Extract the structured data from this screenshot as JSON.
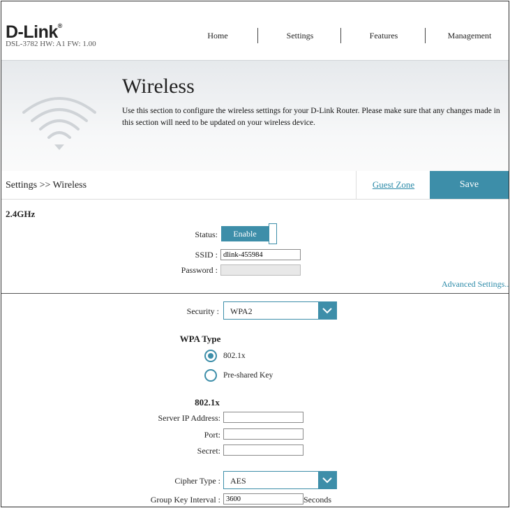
{
  "brand": {
    "logo": "D-Link",
    "model_info": "DSL-3782  HW: A1  FW: 1.00"
  },
  "nav": [
    {
      "label": "Home"
    },
    {
      "label": "Settings"
    },
    {
      "label": "Features"
    },
    {
      "label": "Management"
    }
  ],
  "banner": {
    "title": "Wireless",
    "description": "Use this section to configure the wireless settings for your D-Link Router. Please make sure that any changes made in this section will need to be updated on your wireless device.",
    "icon": "wifi-icon"
  },
  "breadcrumb": "Settings >> Wireless",
  "actions": {
    "guest_zone": "Guest Zone",
    "save": "Save"
  },
  "band": {
    "title": "2.4GHz",
    "status_label": "Status:",
    "status_value": "Enable",
    "ssid_label": "SSID :",
    "ssid_value": "dlink-455984",
    "password_label": "Password :",
    "password_value": "",
    "advanced_link": "Advanced Settings..."
  },
  "security": {
    "label": "Security :",
    "value": "WPA2",
    "wpa_type_title": "WPA Type",
    "wpa_options": [
      {
        "label": "802.1x",
        "checked": true
      },
      {
        "label": "Pre-shared Key",
        "checked": false
      }
    ],
    "radius_title": "802.1x",
    "server_ip_label": "Server IP Address:",
    "server_ip_value": "",
    "port_label": "Port:",
    "port_value": "",
    "secret_label": "Secret:",
    "secret_value": "",
    "cipher_label": "Cipher Type :",
    "cipher_value": "AES",
    "group_key_label": "Group Key Interval :",
    "group_key_value": "3600",
    "group_key_unit": "Seconds"
  },
  "colors": {
    "accent": "#3d8ea9",
    "link": "#2b8aa8"
  }
}
